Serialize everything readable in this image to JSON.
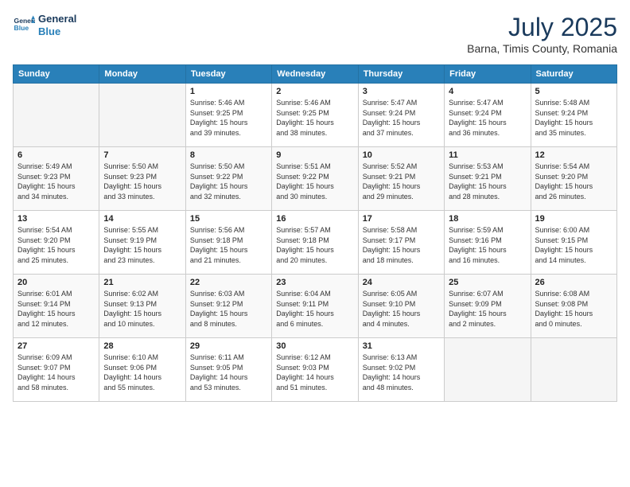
{
  "logo": {
    "line1": "General",
    "line2": "Blue"
  },
  "title": "July 2025",
  "location": "Barna, Timis County, Romania",
  "headers": [
    "Sunday",
    "Monday",
    "Tuesday",
    "Wednesday",
    "Thursday",
    "Friday",
    "Saturday"
  ],
  "weeks": [
    [
      {
        "day": "",
        "info": ""
      },
      {
        "day": "",
        "info": ""
      },
      {
        "day": "1",
        "info": "Sunrise: 5:46 AM\nSunset: 9:25 PM\nDaylight: 15 hours\nand 39 minutes."
      },
      {
        "day": "2",
        "info": "Sunrise: 5:46 AM\nSunset: 9:25 PM\nDaylight: 15 hours\nand 38 minutes."
      },
      {
        "day": "3",
        "info": "Sunrise: 5:47 AM\nSunset: 9:24 PM\nDaylight: 15 hours\nand 37 minutes."
      },
      {
        "day": "4",
        "info": "Sunrise: 5:47 AM\nSunset: 9:24 PM\nDaylight: 15 hours\nand 36 minutes."
      },
      {
        "day": "5",
        "info": "Sunrise: 5:48 AM\nSunset: 9:24 PM\nDaylight: 15 hours\nand 35 minutes."
      }
    ],
    [
      {
        "day": "6",
        "info": "Sunrise: 5:49 AM\nSunset: 9:23 PM\nDaylight: 15 hours\nand 34 minutes."
      },
      {
        "day": "7",
        "info": "Sunrise: 5:50 AM\nSunset: 9:23 PM\nDaylight: 15 hours\nand 33 minutes."
      },
      {
        "day": "8",
        "info": "Sunrise: 5:50 AM\nSunset: 9:22 PM\nDaylight: 15 hours\nand 32 minutes."
      },
      {
        "day": "9",
        "info": "Sunrise: 5:51 AM\nSunset: 9:22 PM\nDaylight: 15 hours\nand 30 minutes."
      },
      {
        "day": "10",
        "info": "Sunrise: 5:52 AM\nSunset: 9:21 PM\nDaylight: 15 hours\nand 29 minutes."
      },
      {
        "day": "11",
        "info": "Sunrise: 5:53 AM\nSunset: 9:21 PM\nDaylight: 15 hours\nand 28 minutes."
      },
      {
        "day": "12",
        "info": "Sunrise: 5:54 AM\nSunset: 9:20 PM\nDaylight: 15 hours\nand 26 minutes."
      }
    ],
    [
      {
        "day": "13",
        "info": "Sunrise: 5:54 AM\nSunset: 9:20 PM\nDaylight: 15 hours\nand 25 minutes."
      },
      {
        "day": "14",
        "info": "Sunrise: 5:55 AM\nSunset: 9:19 PM\nDaylight: 15 hours\nand 23 minutes."
      },
      {
        "day": "15",
        "info": "Sunrise: 5:56 AM\nSunset: 9:18 PM\nDaylight: 15 hours\nand 21 minutes."
      },
      {
        "day": "16",
        "info": "Sunrise: 5:57 AM\nSunset: 9:18 PM\nDaylight: 15 hours\nand 20 minutes."
      },
      {
        "day": "17",
        "info": "Sunrise: 5:58 AM\nSunset: 9:17 PM\nDaylight: 15 hours\nand 18 minutes."
      },
      {
        "day": "18",
        "info": "Sunrise: 5:59 AM\nSunset: 9:16 PM\nDaylight: 15 hours\nand 16 minutes."
      },
      {
        "day": "19",
        "info": "Sunrise: 6:00 AM\nSunset: 9:15 PM\nDaylight: 15 hours\nand 14 minutes."
      }
    ],
    [
      {
        "day": "20",
        "info": "Sunrise: 6:01 AM\nSunset: 9:14 PM\nDaylight: 15 hours\nand 12 minutes."
      },
      {
        "day": "21",
        "info": "Sunrise: 6:02 AM\nSunset: 9:13 PM\nDaylight: 15 hours\nand 10 minutes."
      },
      {
        "day": "22",
        "info": "Sunrise: 6:03 AM\nSunset: 9:12 PM\nDaylight: 15 hours\nand 8 minutes."
      },
      {
        "day": "23",
        "info": "Sunrise: 6:04 AM\nSunset: 9:11 PM\nDaylight: 15 hours\nand 6 minutes."
      },
      {
        "day": "24",
        "info": "Sunrise: 6:05 AM\nSunset: 9:10 PM\nDaylight: 15 hours\nand 4 minutes."
      },
      {
        "day": "25",
        "info": "Sunrise: 6:07 AM\nSunset: 9:09 PM\nDaylight: 15 hours\nand 2 minutes."
      },
      {
        "day": "26",
        "info": "Sunrise: 6:08 AM\nSunset: 9:08 PM\nDaylight: 15 hours\nand 0 minutes."
      }
    ],
    [
      {
        "day": "27",
        "info": "Sunrise: 6:09 AM\nSunset: 9:07 PM\nDaylight: 14 hours\nand 58 minutes."
      },
      {
        "day": "28",
        "info": "Sunrise: 6:10 AM\nSunset: 9:06 PM\nDaylight: 14 hours\nand 55 minutes."
      },
      {
        "day": "29",
        "info": "Sunrise: 6:11 AM\nSunset: 9:05 PM\nDaylight: 14 hours\nand 53 minutes."
      },
      {
        "day": "30",
        "info": "Sunrise: 6:12 AM\nSunset: 9:03 PM\nDaylight: 14 hours\nand 51 minutes."
      },
      {
        "day": "31",
        "info": "Sunrise: 6:13 AM\nSunset: 9:02 PM\nDaylight: 14 hours\nand 48 minutes."
      },
      {
        "day": "",
        "info": ""
      },
      {
        "day": "",
        "info": ""
      }
    ]
  ]
}
